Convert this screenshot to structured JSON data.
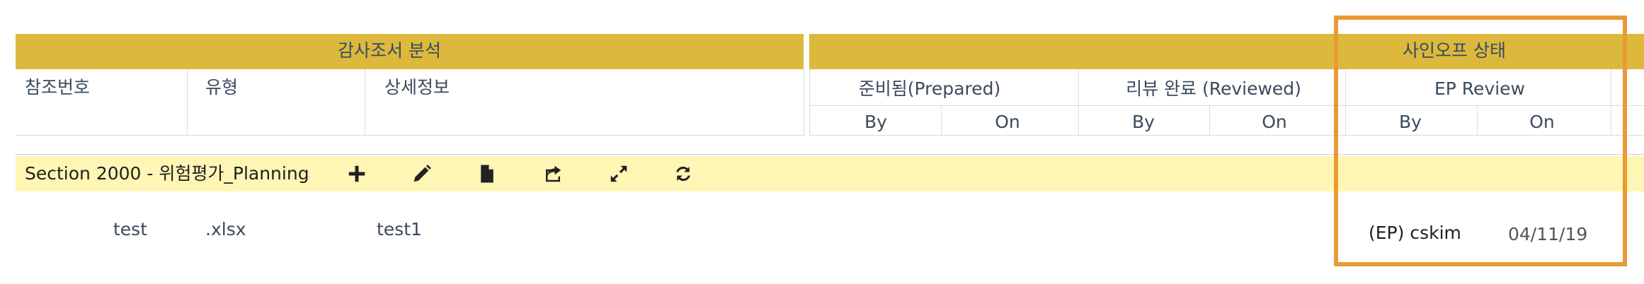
{
  "groups": {
    "audit_analysis": "감사조서 분석",
    "signoff_status": "사인오프 상태"
  },
  "columns": {
    "ref_no": "참조번호",
    "type": "유형",
    "detail": "상세정보",
    "prepared": "준비됨(Prepared)",
    "reviewed": "리뷰 완료 (Reviewed)",
    "ep_review": "EP Review"
  },
  "subcols": {
    "prepared_by": "By",
    "prepared_on": "On",
    "reviewed_by": "By",
    "reviewed_on": "On",
    "ep_by": "By",
    "ep_on": "On"
  },
  "section": {
    "title": "Section 2000 - 위험평가_Planning",
    "tools": [
      "add-icon",
      "edit-icon",
      "document-icon",
      "share-icon",
      "expand-icon",
      "refresh-icon"
    ]
  },
  "rows": [
    {
      "ref_no": "test",
      "type": ".xlsx",
      "detail": "test1",
      "ep_by": "(EP) cskim",
      "ep_on": "04/11/19"
    }
  ],
  "colors": {
    "header_gold": "#dcb93c",
    "section_yellow": "#fff6b5",
    "highlight_orange": "#e99a35",
    "text": "#3a4a5e"
  }
}
